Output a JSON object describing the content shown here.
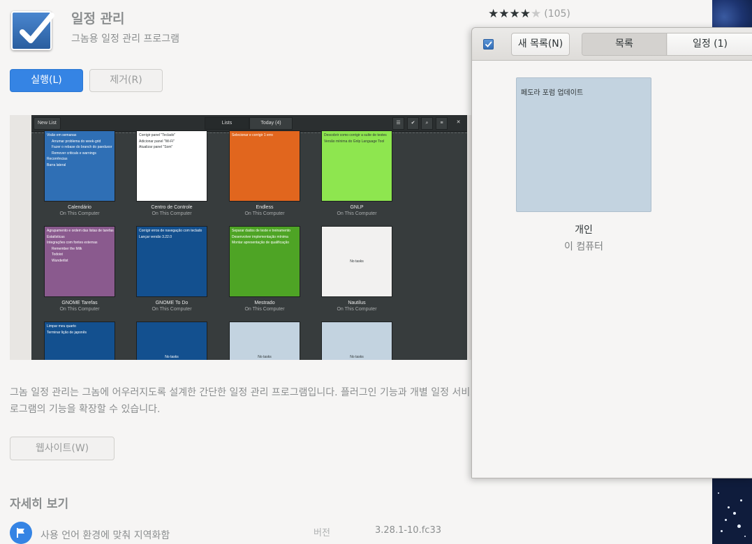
{
  "app": {
    "title": "일정 관리",
    "summary": "그놈용 일정 관리 프로그램",
    "rating_stars": 4,
    "rating_max": 5,
    "review_count": "(105)"
  },
  "actions": {
    "run_label": "실행(L)",
    "remove_label": "제거(R)"
  },
  "screenshot": {
    "new_list_label": "New List",
    "tabs": [
      "Lists",
      "Today (4)"
    ],
    "cards": [
      {
        "name": "Calendário",
        "location": "On This Computer",
        "color": "#2f6fb5",
        "text_color": "#ffffff",
        "items": [
          {
            "text": "Visão em semanas",
            "indent": false
          },
          {
            "text": "Arrumar problema do week-grid",
            "indent": true
          },
          {
            "text": "Fazer o rebase do branch do paeduxor",
            "indent": true
          },
          {
            "text": "Remover criticals e warnings",
            "indent": true
          },
          {
            "text": "Recorrências",
            "indent": false
          },
          {
            "text": "Barra lateral",
            "indent": false
          }
        ]
      },
      {
        "name": "Centro de Controle",
        "location": "On This Computer",
        "color": "#ffffff",
        "text_color": "#2e3436",
        "items": [
          {
            "text": "Corrigir panel \"Teclado\"",
            "indent": false
          },
          {
            "text": "Adicionar panel \"Wi-Fi\"",
            "indent": false
          },
          {
            "text": "Atualizar panel \"Som\"",
            "indent": false
          }
        ]
      },
      {
        "name": "Endless",
        "location": "On This Computer",
        "color": "#e1661e",
        "text_color": "#ffffff",
        "items": [
          {
            "text": "Selecionar e corrigir 1 erro",
            "indent": false
          }
        ]
      },
      {
        "name": "GNLP",
        "location": "On This Computer",
        "color": "#8ee64f",
        "text_color": "#2e3436",
        "items": [
          {
            "text": "Descobrir como corrigir a suíte de testes",
            "indent": false
          },
          {
            "text": "Versão mínima do Gnlp Language Tool",
            "indent": false
          }
        ]
      },
      {
        "name": "GNOME Tarefas",
        "location": "On This Computer",
        "color": "#8a5a8e",
        "text_color": "#ffffff",
        "items": [
          {
            "text": "Agrupamento e ordem das listas de tarefas",
            "indent": false
          },
          {
            "text": "Estatísticas",
            "indent": false
          },
          {
            "text": "Integrações com fontes externas",
            "indent": false
          },
          {
            "text": "Remember the Milk",
            "indent": true
          },
          {
            "text": "Todoist",
            "indent": true
          },
          {
            "text": "Wunderlist",
            "indent": true
          }
        ]
      },
      {
        "name": "GNOME To Do",
        "location": "On This Computer",
        "color": "#13508f",
        "text_color": "#ffffff",
        "items": [
          {
            "text": "Corrigir erros de navegação com teclado",
            "indent": false
          },
          {
            "text": "Lançar versão 3.22.0",
            "indent": false
          }
        ]
      },
      {
        "name": "Mestrado",
        "location": "On This Computer",
        "color": "#4ea425",
        "text_color": "#ffffff",
        "items": [
          {
            "text": "Separar dados de teste e treinamento",
            "indent": false
          },
          {
            "text": "Desenvolver implementação mínima",
            "indent": false
          },
          {
            "text": "Montar apresentação de qualificação",
            "indent": false
          }
        ]
      },
      {
        "name": "Nautilus",
        "location": "On This Computer",
        "color": "#f2f1f0",
        "text_color": "#2e3436",
        "items": [],
        "empty_label": "No tasks"
      },
      {
        "name": "",
        "location": "",
        "color": "#13508f",
        "text_color": "#ffffff",
        "items": [
          {
            "text": "Limpar meu quarto",
            "indent": false
          },
          {
            "text": "Terminar lição de japonês",
            "indent": false
          }
        ]
      },
      {
        "name": "",
        "location": "",
        "color": "#13508f",
        "text_color": "#ffffff",
        "items": [],
        "empty_label": "No tasks"
      },
      {
        "name": "",
        "location": "",
        "color": "#c3d3e0",
        "text_color": "#2e3436",
        "items": [],
        "empty_label": "No tasks"
      },
      {
        "name": "",
        "location": "",
        "color": "#c3d3e0",
        "text_color": "#2e3436",
        "items": [],
        "empty_label": "No tasks"
      }
    ]
  },
  "description": {
    "line1": "그놈 일정 관리는 그놈에 어우러지도록 설계한 간단한 일정 관리 프로그램입니다. 플러그인 기능과 개별 일정 서비스",
    "line2": "로그램의 기능을 확장할 수 있습니다."
  },
  "website_label": "웹사이트(W)",
  "details": {
    "heading": "자세히 보기",
    "localization_label": "사용 언어 환경에 맞춰 지역화함",
    "version_label": "버전",
    "version_value": "3.28.1-10.fc33"
  },
  "todo_window": {
    "new_list_label": "새 목록(N)",
    "tab_lists": "목록",
    "tab_today": "일정 (1)",
    "list_card": {
      "task": "페도라 포럼 업데이트",
      "name": "개인",
      "location": "이 컴퓨터",
      "color": "#c3d3e0"
    }
  },
  "colors": {
    "accent": "#3584e4"
  }
}
